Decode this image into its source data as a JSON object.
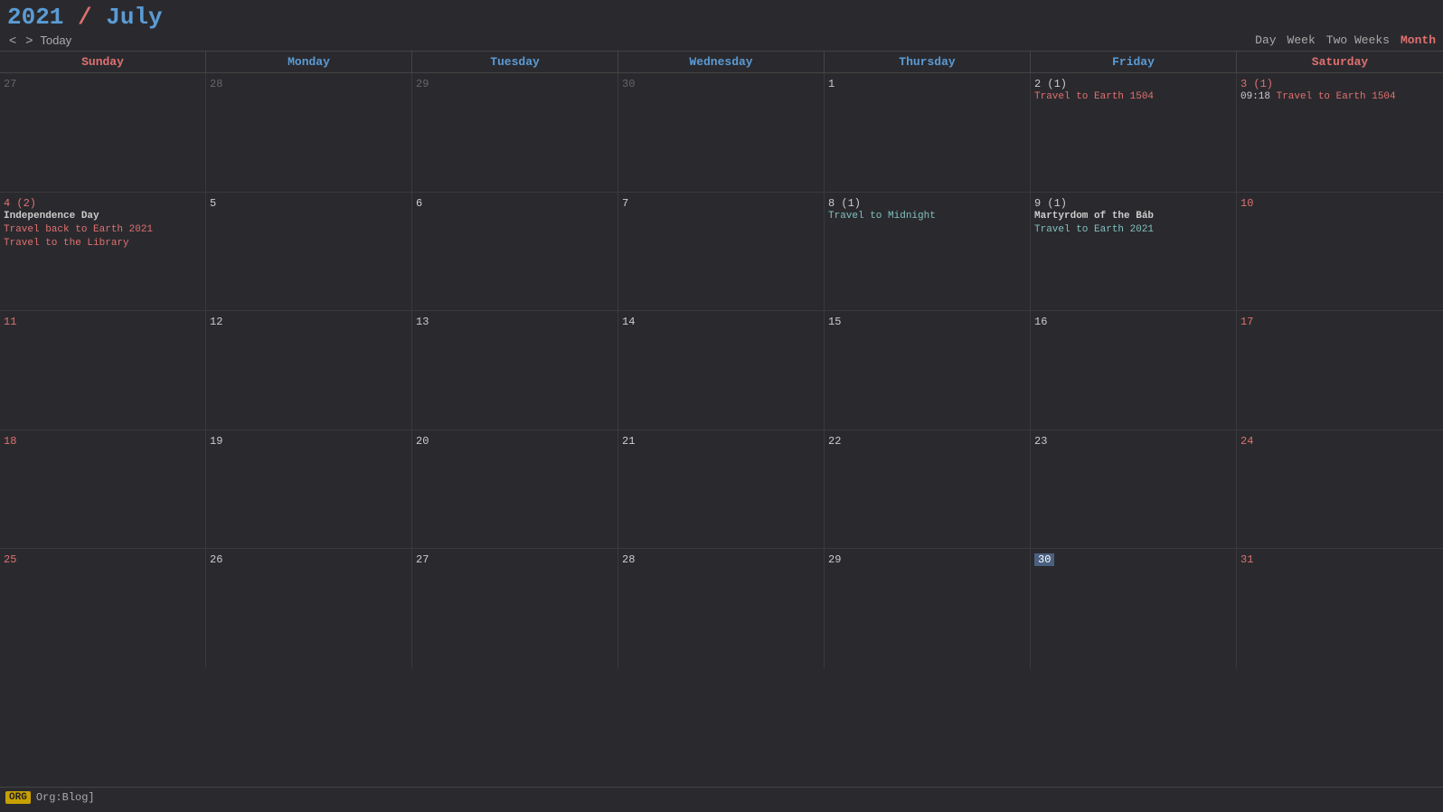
{
  "header": {
    "year": "2021",
    "slash": " / ",
    "month": "July",
    "nav": {
      "prev": "<",
      "next": ">",
      "today": "Today"
    },
    "views": [
      "Day",
      "Week",
      "Two Weeks",
      "Month"
    ],
    "active_view": "Month"
  },
  "day_headers": [
    {
      "label": "Sunday",
      "type": "weekend"
    },
    {
      "label": "Monday",
      "type": "weekday"
    },
    {
      "label": "Tuesday",
      "type": "weekday"
    },
    {
      "label": "Wednesday",
      "type": "weekday"
    },
    {
      "label": "Thursday",
      "type": "weekday"
    },
    {
      "label": "Friday",
      "type": "weekday"
    },
    {
      "label": "Saturday",
      "type": "weekend"
    }
  ],
  "weeks": [
    {
      "days": [
        {
          "date": "27",
          "out_of_month": true,
          "weekend": true,
          "events": []
        },
        {
          "date": "28",
          "out_of_month": true,
          "events": []
        },
        {
          "date": "29",
          "out_of_month": true,
          "events": []
        },
        {
          "date": "30",
          "out_of_month": true,
          "events": []
        },
        {
          "date": "1",
          "events": []
        },
        {
          "date": "2",
          "event_count": "(1)",
          "events": [
            {
              "text": "Travel to Earth 1504",
              "type": "orange"
            }
          ]
        },
        {
          "date": "3",
          "weekend": true,
          "event_count": "(1)",
          "events": [
            {
              "time": "09:18",
              "text": "Travel to Earth 1504",
              "type": "time_orange"
            }
          ]
        }
      ]
    },
    {
      "days": [
        {
          "date": "4",
          "weekend": true,
          "event_count": "(2)",
          "events": [
            {
              "text": "Independence Day",
              "type": "bold"
            },
            {
              "text": "Travel back to Earth 2021",
              "type": "orange"
            },
            {
              "text": "Travel to the Library",
              "type": "orange"
            }
          ]
        },
        {
          "date": "5",
          "events": []
        },
        {
          "date": "6",
          "events": []
        },
        {
          "date": "7",
          "events": []
        },
        {
          "date": "8",
          "event_count": "(1)",
          "events": [
            {
              "text": "Travel to Midnight",
              "type": "cyan"
            }
          ]
        },
        {
          "date": "9",
          "event_count": "(1)",
          "events": [
            {
              "text": "Martyrdom of the Báb",
              "type": "bold_orange"
            },
            {
              "text": "Travel to Earth 2021",
              "type": "cyan"
            }
          ]
        },
        {
          "date": "10",
          "weekend": true,
          "events": []
        }
      ]
    },
    {
      "days": [
        {
          "date": "11",
          "weekend": true,
          "events": []
        },
        {
          "date": "12",
          "events": []
        },
        {
          "date": "13",
          "events": []
        },
        {
          "date": "14",
          "events": []
        },
        {
          "date": "15",
          "events": []
        },
        {
          "date": "16",
          "events": []
        },
        {
          "date": "17",
          "weekend": true,
          "events": []
        }
      ]
    },
    {
      "days": [
        {
          "date": "18",
          "weekend": true,
          "events": []
        },
        {
          "date": "19",
          "events": []
        },
        {
          "date": "20",
          "events": []
        },
        {
          "date": "21",
          "events": []
        },
        {
          "date": "22",
          "events": []
        },
        {
          "date": "23",
          "events": []
        },
        {
          "date": "24",
          "weekend": true,
          "events": []
        }
      ]
    },
    {
      "days": [
        {
          "date": "25",
          "weekend": true,
          "events": []
        },
        {
          "date": "26",
          "events": []
        },
        {
          "date": "27",
          "events": []
        },
        {
          "date": "28",
          "events": []
        },
        {
          "date": "29",
          "events": []
        },
        {
          "date": "30",
          "today": true,
          "events": []
        },
        {
          "date": "31",
          "weekend": true,
          "events": []
        }
      ]
    }
  ],
  "status_bar": {
    "tag": "ORG",
    "text": "Org:Blog]"
  }
}
